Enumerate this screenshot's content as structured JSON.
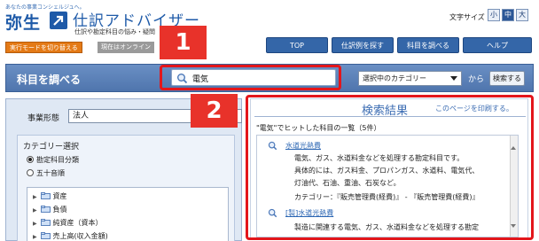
{
  "brand": {
    "tagline": "あなたの事業コンシェルジュへ。",
    "logo_text": "弥生",
    "app_title": "仕訳アドバイザー",
    "subtitle": "仕訳や勘定科目の悩み・疑問"
  },
  "font_size": {
    "label": "文字サイズ",
    "options": [
      "小",
      "中",
      "大"
    ],
    "selected": "中"
  },
  "nav": {
    "items": [
      "TOP",
      "仕訳例を探す",
      "科目を調べる",
      "ヘルプ"
    ]
  },
  "tags": {
    "mode_button": "実行モードを切り替える",
    "status": "現在はオンライン"
  },
  "search": {
    "title": "科目を調べる",
    "query": "電気",
    "category_select": "選択中のカテゴリー",
    "kara": "から",
    "button": "検索する"
  },
  "badges": [
    "1",
    "2"
  ],
  "left": {
    "business_type_label": "事業形態",
    "business_type_value": "法人",
    "category_heading": "カテゴリー選択",
    "radios": [
      {
        "label": "勘定科目分類",
        "checked": true
      },
      {
        "label": "五十音順",
        "checked": false
      }
    ],
    "tree": [
      "資産",
      "負債",
      "純資産（資本）",
      "売上高(収入金額)"
    ]
  },
  "results": {
    "title": "検索結果",
    "print_link": "このページを印刷する。",
    "summary": "\"電気\"でヒットした科目の一覧（5件）",
    "items": [
      {
        "title": "水道光熱費",
        "lines": [
          "電気、ガス、水道料金などを処理する勘定科目です。",
          "具体的には、ガス料金、プロパンガス、水道料、電気代、",
          "灯油代、石油、重油、石炭など。",
          "カテゴリー：『販売管理費(経費)』 - 『販売管理費(経費)』"
        ]
      },
      {
        "title": "[製]水道光熱費",
        "lines": [
          "製造に関連する電気、ガス、水道料金などを処理する勘定"
        ]
      }
    ]
  },
  "colors": {
    "brand_blue": "#1e5aa8",
    "nav_blue": "#3466a8",
    "highlight_red": "#e3161b",
    "badge_red": "#e8322a",
    "tag_orange": "#e47a16"
  }
}
